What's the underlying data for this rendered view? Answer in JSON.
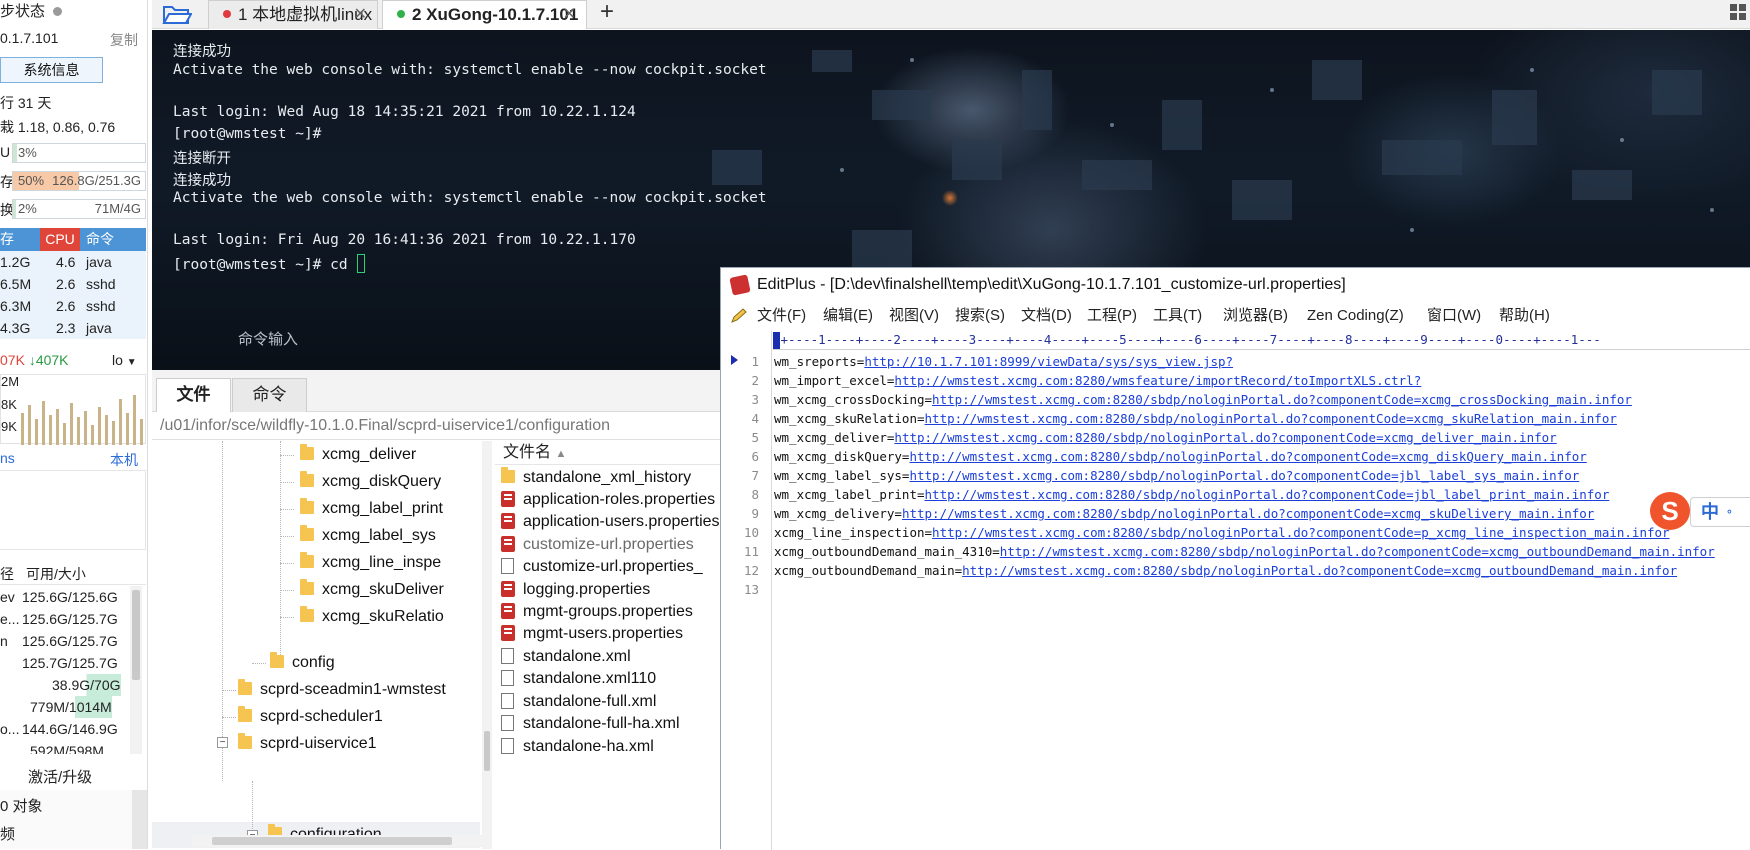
{
  "left_panel": {
    "sync_status": "步状态",
    "ip": "0.1.7.101",
    "copy_label": "复制",
    "sysinfo_button": "系统信息",
    "uptime": "行 31 天",
    "load": "栽 1.18, 0.86, 0.76",
    "cpu": {
      "label": "U",
      "value": "3%",
      "percent": 3
    },
    "mem": {
      "label": "存",
      "value": "50%",
      "detail": "126.8G/251.3G",
      "percent": 50
    },
    "swap": {
      "label": "换",
      "value": "2%",
      "detail": "71M/4G",
      "percent": 2
    },
    "proc_headers": [
      "存",
      "CPU",
      "命令"
    ],
    "processes": [
      {
        "mem": "1.2G",
        "cpu": "4.6",
        "cmd": "java"
      },
      {
        "mem": "6.5M",
        "cpu": "2.6",
        "cmd": "sshd"
      },
      {
        "mem": "6.3M",
        "cpu": "2.6",
        "cmd": "sshd"
      },
      {
        "mem": "4.3G",
        "cpu": "2.3",
        "cmd": "java"
      }
    ],
    "net_up": "07K",
    "net_down": "407K",
    "net_iface": "lo",
    "net_scale": [
      "2M",
      "8K",
      "9K"
    ],
    "ping_label": "ns",
    "ping_host": "本机",
    "disk_headers": [
      "径",
      "可用/大小"
    ],
    "disks": [
      {
        "path": "ev",
        "size": "125.6G/125.6G"
      },
      {
        "path": "e...",
        "size": "125.6G/125.7G"
      },
      {
        "path": "n",
        "size": "125.6G/125.7G"
      },
      {
        "path": "",
        "size": "125.7G/125.7G"
      },
      {
        "path": "",
        "size": "38.9G/70G"
      },
      {
        "path": "",
        "size": "779M/1014M"
      },
      {
        "path": "o...",
        "size": "144.6G/146.9G"
      },
      {
        "path": "",
        "size": "592M/598M"
      }
    ],
    "activate": "激活/升级",
    "objects": "0 对象",
    "freq": "频"
  },
  "tabs": [
    {
      "label": "1 本地虚拟机linux",
      "color": "#e0393e"
    },
    {
      "label": "2 XuGong-10.1.7.101",
      "color": "#2fb24c"
    }
  ],
  "add_tab": "+",
  "terminal": {
    "lines": [
      "连接成功",
      "Activate the web console with: systemctl enable --now cockpit.socket",
      "",
      "Last login: Wed Aug 18 14:35:21 2021 from 10.22.1.124",
      "[root@wmstest ~]#",
      "连接断开",
      "连接成功",
      "Activate the web console with: systemctl enable --now cockpit.socket",
      "",
      "Last login: Fri Aug 20 16:41:36 2021 from 10.22.1.170",
      "[root@wmstest ~]# cd "
    ],
    "command_input": "命令输入"
  },
  "filemgr": {
    "tabs": [
      "文件",
      "命令"
    ],
    "path": "/u01/infor/sce/wildfly-10.1.0.Final/scprd-uiservice1/configuration",
    "tree": [
      "xcmg_deliver",
      "xcmg_diskQuery",
      "xcmg_label_print",
      "xcmg_label_sys",
      "xcmg_line_inspe",
      "xcmg_skuDeliver",
      "xcmg_skuRelatio",
      "config",
      "scprd-sceadmin1-wmstest",
      "scprd-scheduler1",
      "scprd-uiservice1",
      "configuration"
    ],
    "file_header": "文件名",
    "files": [
      {
        "name": "standalone_xml_history",
        "type": "folder"
      },
      {
        "name": "application-roles.properties",
        "type": "prop"
      },
      {
        "name": "application-users.properties",
        "type": "prop"
      },
      {
        "name": "customize-url.properties",
        "type": "prop"
      },
      {
        "name": "customize-url.properties_",
        "type": "doc"
      },
      {
        "name": "logging.properties",
        "type": "prop"
      },
      {
        "name": "mgmt-groups.properties",
        "type": "prop"
      },
      {
        "name": "mgmt-users.properties",
        "type": "prop"
      },
      {
        "name": "standalone.xml",
        "type": "doc"
      },
      {
        "name": "standalone.xml110",
        "type": "doc"
      },
      {
        "name": "standalone-full.xml",
        "type": "doc"
      },
      {
        "name": "standalone-full-ha.xml",
        "type": "doc"
      },
      {
        "name": "standalone-ha.xml",
        "type": "doc"
      }
    ]
  },
  "editplus": {
    "title": "EditPlus - [D:\\dev\\finalshell\\temp\\edit\\XuGong-10.1.7.101_customize-url.properties]",
    "menu": [
      "文件(F)",
      "编辑(E)",
      "视图(V)",
      "搜索(S)",
      "文档(D)",
      "工程(P)",
      "工具(T)",
      "浏览器(B)",
      "Zen Coding(Z)",
      "窗口(W)",
      "帮助(H)"
    ],
    "ruler": "-+----1----+----2----+----3----+----4----+----5----+----6----+----7----+----8----+----9----+----0----+----1---",
    "lines": [
      {
        "n": "1",
        "key": "wm_sreports=",
        "url": "http://10.1.7.101:8999/viewData/sys/sys_view.jsp?"
      },
      {
        "n": "2",
        "key": "wm_import_excel=",
        "url": "http://wmstest.xcmg.com:8280/wmsfeature/importRecord/toImportXLS.ctrl?"
      },
      {
        "n": "3",
        "key": "wm_xcmg_crossDocking=",
        "url": "http://wmstest.xcmg.com:8280/sbdp/nologinPortal.do?componentCode=xcmg_crossDocking_main.infor"
      },
      {
        "n": "4",
        "key": "wm_xcmg_skuRelation=",
        "url": "http://wmstest.xcmg.com:8280/sbdp/nologinPortal.do?componentCode=xcmg_skuRelation_main.infor"
      },
      {
        "n": "5",
        "key": "wm_xcmg_deliver=",
        "url": "http://wmstest.xcmg.com:8280/sbdp/nologinPortal.do?componentCode=xcmg_deliver_main.infor"
      },
      {
        "n": "6",
        "key": "wm_xcmg_diskQuery=",
        "url": "http://wmstest.xcmg.com:8280/sbdp/nologinPortal.do?componentCode=xcmg_diskQuery_main.infor"
      },
      {
        "n": "7",
        "key": "wm_xcmg_label_sys=",
        "url": "http://wmstest.xcmg.com:8280/sbdp/nologinPortal.do?componentCode=jbl_label_sys_main.infor"
      },
      {
        "n": "8",
        "key": "wm_xcmg_label_print=",
        "url": "http://wmstest.xcmg.com:8280/sbdp/nologinPortal.do?componentCode=jbl_label_print_main.infor"
      },
      {
        "n": "9",
        "key": "wm_xcmg_delivery=",
        "url": "http://wmstest.xcmg.com:8280/sbdp/nologinPortal.do?componentCode=xcmg_skuDelivery_main.infor"
      },
      {
        "n": "10",
        "key": "xcmg_line_inspection=",
        "url": "http://wmstest.xcmg.com:8280/sbdp/nologinPortal.do?componentCode=p_xcmg_line_inspection_main.infor"
      },
      {
        "n": "11",
        "key": "xcmg_outboundDemand_main_4310=",
        "url": "http://wmstest.xcmg.com:8280/sbdp/nologinPortal.do?componentCode=xcmg_outboundDemand_main.infor"
      },
      {
        "n": "12",
        "key": "xcmg_outboundDemand_main=",
        "url": "http://wmstest.xcmg.com:8280/sbdp/nologinPortal.do?componentCode=xcmg_outboundDemand_main.infor"
      },
      {
        "n": "13",
        "key": "",
        "url": ""
      }
    ]
  },
  "ime": {
    "logo": "S",
    "mode": "中"
  }
}
